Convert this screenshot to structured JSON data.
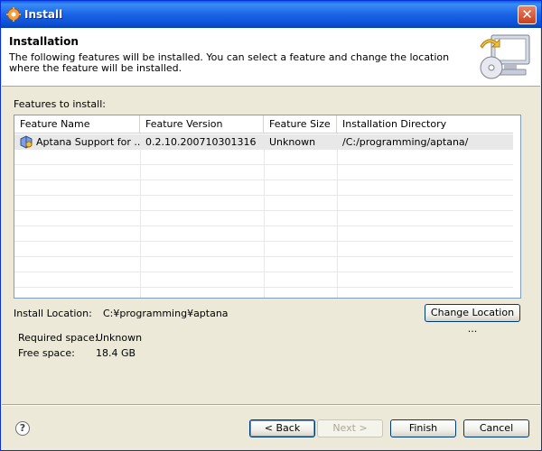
{
  "window": {
    "title": "Install",
    "title_icon": "gear-icon",
    "close_icon": "close-icon"
  },
  "header": {
    "title": "Installation",
    "description": "The following features will be installed. You can select a feature and change the location where the feature will be installed.",
    "art_icon": "install-cd-monitor-icon"
  },
  "features": {
    "label": "Features to install:",
    "label_mnemonic": "i",
    "columns": [
      "Feature Name",
      "Feature Version",
      "Feature Size",
      "Installation Directory"
    ],
    "rows": [
      {
        "icon": "feature-plugin-icon",
        "name": "Aptana Support for ...",
        "version": "0.2.10.200710301316",
        "size": "Unknown",
        "directory": "/C:/programming/aptana/"
      }
    ]
  },
  "install_location": {
    "label": "Install Location:",
    "value": "C:¥programming¥aptana",
    "change_button": "Change Location ..."
  },
  "space": {
    "required_label": "Required space:",
    "required_value": "Unknown",
    "free_label": "Free space:",
    "free_value": "18.4 GB"
  },
  "buttons": {
    "help": "?",
    "back": "< Back",
    "next": "Next >",
    "finish": "Finish",
    "cancel": "Cancel"
  },
  "colors": {
    "titlebar": "#0a5fe0",
    "dialog_bg": "#ece9d8",
    "selected_row": "#e8e8e8",
    "table_border": "#7f9db9"
  }
}
